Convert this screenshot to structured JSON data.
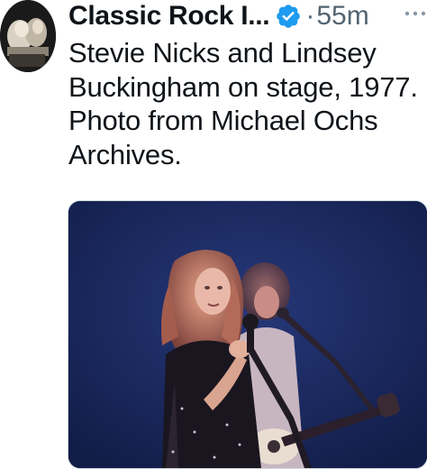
{
  "tweet": {
    "author_name": "Classic Rock I...",
    "verified_icon": "verified-badge-icon",
    "separator": "·",
    "time": "55m",
    "more_icon": "more-options-icon",
    "text": "Stevie Nicks and Lindsey Buckingham on stage, 1977. Photo from Michael Ochs Archives."
  },
  "colors": {
    "verified": "#1d9bf0",
    "secondary_text": "#536471",
    "primary_text": "#0f1419",
    "photo_background": "#1b2a5e"
  }
}
